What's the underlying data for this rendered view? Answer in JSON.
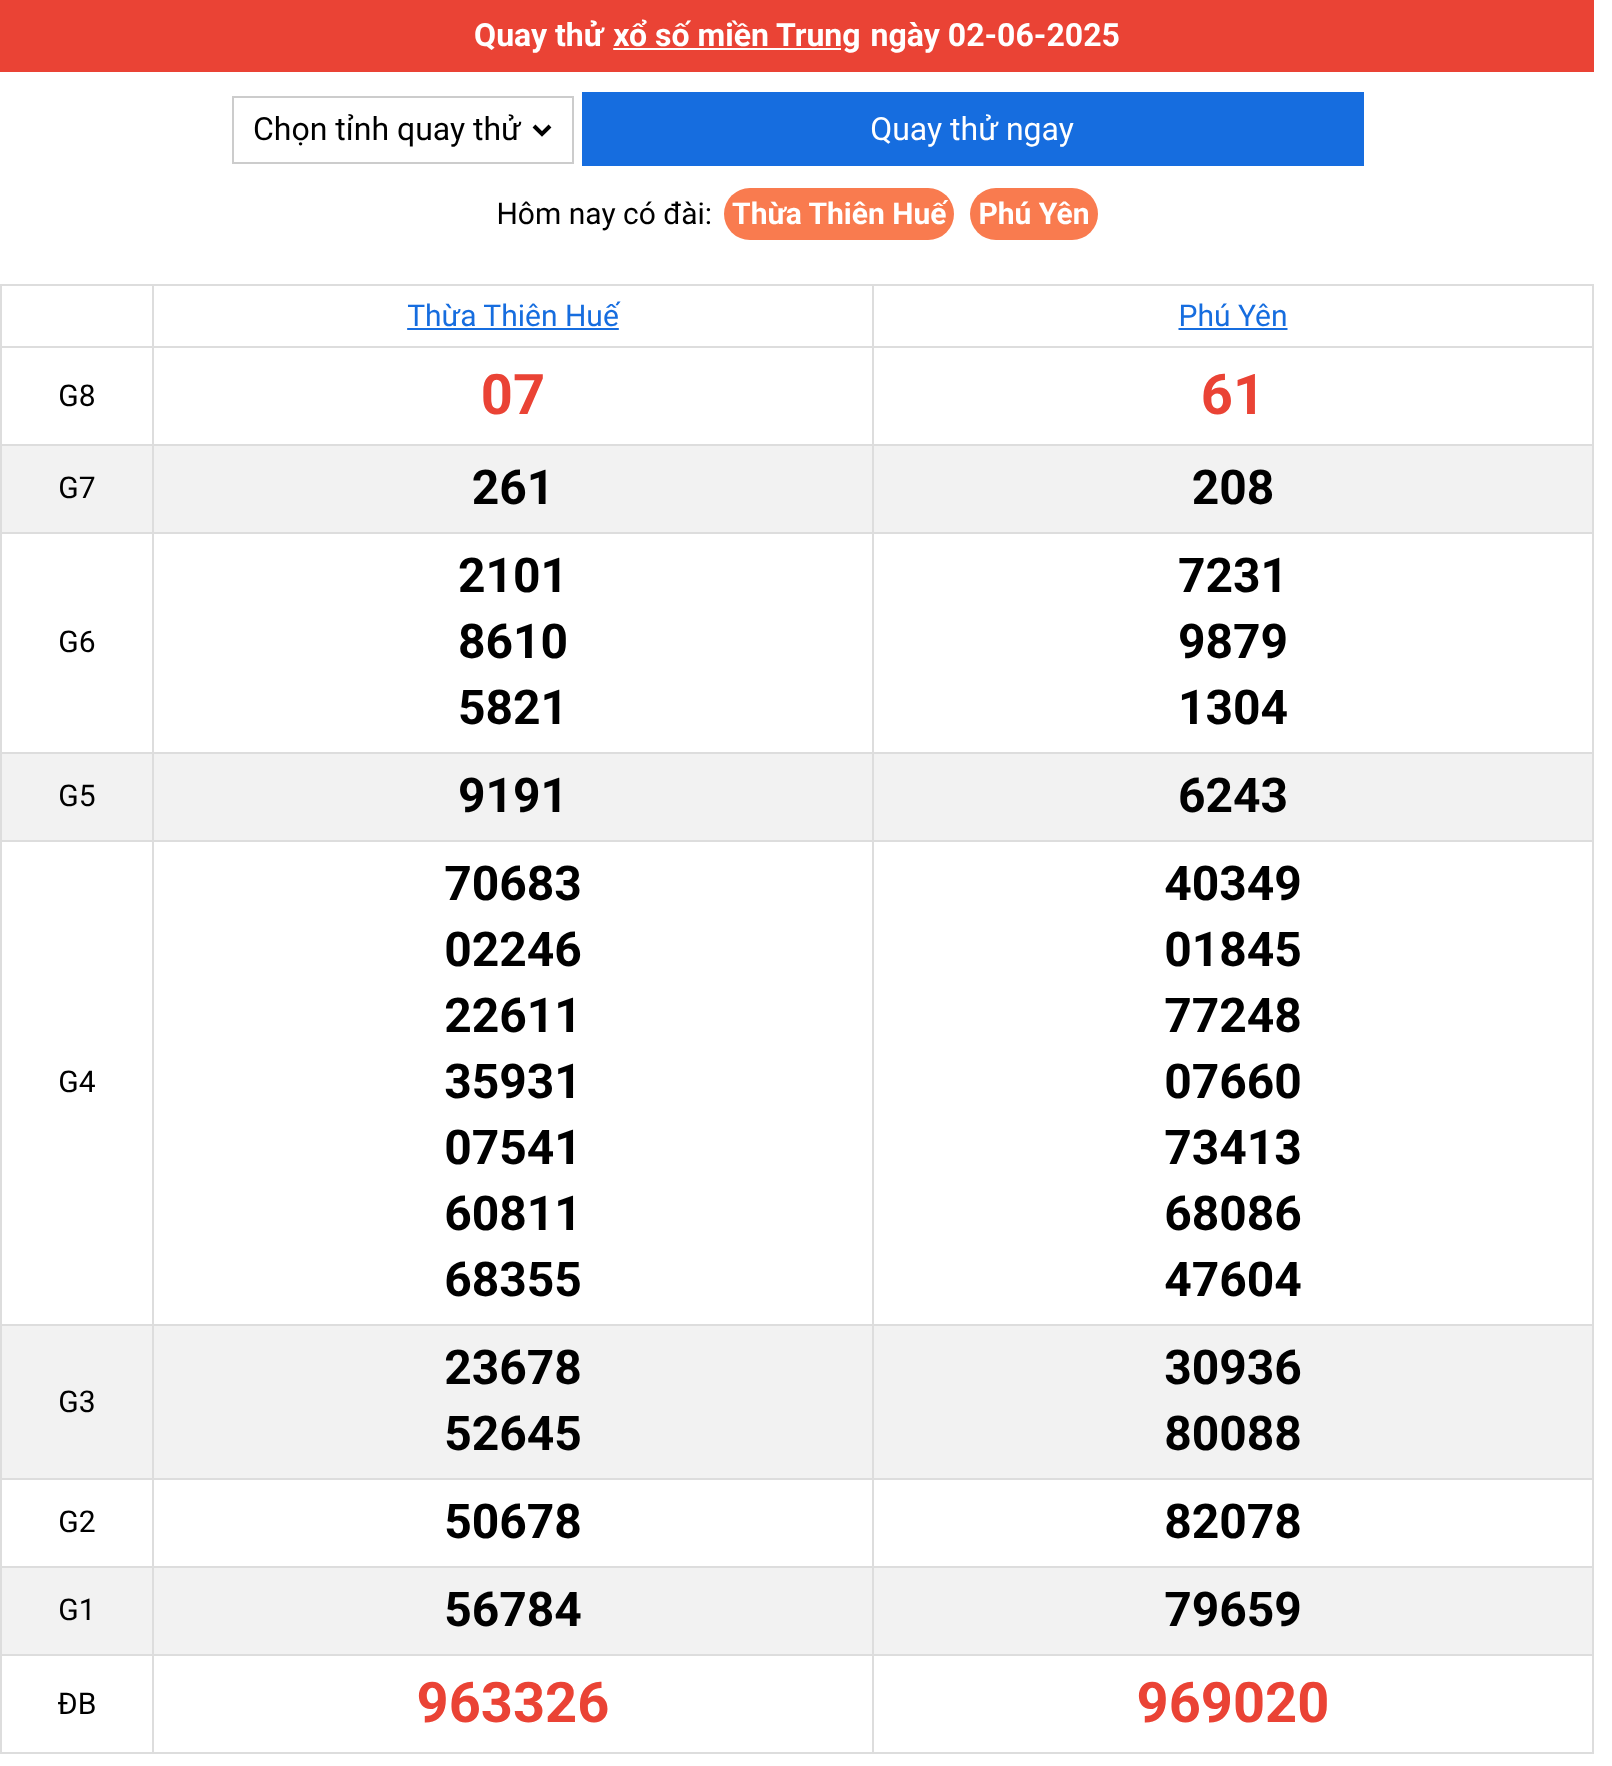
{
  "header": {
    "prefix": "Quay thử",
    "link": "xổ số miền Trung",
    "suffix": "ngày 02-06-2025"
  },
  "province_select": {
    "value": "Chọn tỉnh quay thử"
  },
  "spin_button": "Quay thử ngay",
  "today": {
    "label": "Hôm nay có đài:",
    "stations": [
      "Thừa Thiên Huế",
      "Phú Yên"
    ]
  },
  "table": {
    "columns": [
      "Thừa Thiên Huế",
      "Phú Yên"
    ],
    "rows": [
      {
        "prize": "G8",
        "shaded": false,
        "highlight": true,
        "results": [
          [
            "07"
          ],
          [
            "61"
          ]
        ]
      },
      {
        "prize": "G7",
        "shaded": true,
        "highlight": false,
        "results": [
          [
            "261"
          ],
          [
            "208"
          ]
        ]
      },
      {
        "prize": "G6",
        "shaded": false,
        "highlight": false,
        "results": [
          [
            "2101",
            "8610",
            "5821"
          ],
          [
            "7231",
            "9879",
            "1304"
          ]
        ]
      },
      {
        "prize": "G5",
        "shaded": true,
        "highlight": false,
        "results": [
          [
            "9191"
          ],
          [
            "6243"
          ]
        ]
      },
      {
        "prize": "G4",
        "shaded": false,
        "highlight": false,
        "results": [
          [
            "70683",
            "02246",
            "22611",
            "35931",
            "07541",
            "60811",
            "68355"
          ],
          [
            "40349",
            "01845",
            "77248",
            "07660",
            "73413",
            "68086",
            "47604"
          ]
        ]
      },
      {
        "prize": "G3",
        "shaded": true,
        "highlight": false,
        "results": [
          [
            "23678",
            "52645"
          ],
          [
            "30936",
            "80088"
          ]
        ]
      },
      {
        "prize": "G2",
        "shaded": false,
        "highlight": false,
        "results": [
          [
            "50678"
          ],
          [
            "82078"
          ]
        ]
      },
      {
        "prize": "G1",
        "shaded": true,
        "highlight": false,
        "results": [
          [
            "56784"
          ],
          [
            "79659"
          ]
        ]
      },
      {
        "prize": "ĐB",
        "shaded": false,
        "highlight": true,
        "results": [
          [
            "963326"
          ],
          [
            "969020"
          ]
        ]
      }
    ]
  }
}
